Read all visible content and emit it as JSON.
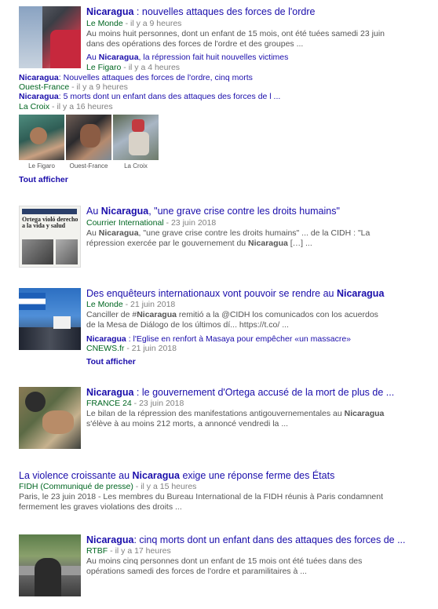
{
  "cluster": {
    "title_prefix": "Nicaragua",
    "title_rest": " : nouvelles attaques des forces de l'ordre",
    "source": "Le Monde",
    "time": " - il y a 9 heures",
    "snippet": "Au moins huit personnes, dont un enfant de 15 mois, ont été tuées samedi 23 juin dans des opérations des forces de l'ordre et des groupes ...",
    "sub1_prefix": "Au ",
    "sub1_bold": "Nicaragua",
    "sub1_rest": ", la répression fait huit nouvelles victimes",
    "sub1_source": "Le Figaro",
    "sub1_time": " - il y a 4 heures",
    "sub2_bold": "Nicaragua",
    "sub2_rest": ": Nouvelles attaques des forces de l'ordre, cinq morts",
    "sub2_source": "Ouest-France",
    "sub2_time": " - il y a 9 heures",
    "sub3_bold": "Nicaragua",
    "sub3_rest": ": 5 morts dont un enfant dans des attaques des forces de l ...",
    "sub3_source": "La Croix",
    "sub3_time": " - il y a 16 heures",
    "thumbs": [
      "Le Figaro",
      "Ouest-France",
      "La Croix"
    ],
    "show_all": "Tout afficher"
  },
  "item1": {
    "title_prefix": "Au ",
    "title_bold": "Nicaragua",
    "title_rest": ", \"une grave crise contre les droits humains\"",
    "source": "Courrier International",
    "time": " - 23 juin 2018",
    "snippet_a": "Au ",
    "snippet_bold": "Nicaragua",
    "snippet_b": ", \"une grave crise contre les droits humains\" ... de la CIDH : \"La répression exercée par le gouvernement du ",
    "snippet_bold2": "Nicaragua",
    "snippet_c": " […] ...",
    "thumb_text": "Ortega violó derecho a la vida y salud"
  },
  "item2": {
    "title_prefix": "Des enquêteurs internationaux vont pouvoir se rendre au ",
    "title_bold": "Nicaragua",
    "source": "Le Monde",
    "time": " - 21 juin 2018",
    "snippet_a": "Canciller de #",
    "snippet_bold": "Nicaragua",
    "snippet_b": " remitió a la @CIDH los comunicados con los acuerdos de la Mesa de Diálogo de los últimos dí... https://t.co/ ...",
    "sub_bold": "Nicaragua",
    "sub_rest": " : l'Eglise en renfort à Masaya pour empêcher «un massacre»",
    "sub_source": "CNEWS.fr",
    "sub_time": " - 21 juin 2018",
    "show_all": "Tout afficher"
  },
  "item3": {
    "title_bold": "Nicaragua",
    "title_rest": " : le gouvernement d'Ortega accusé de la mort de plus de ...",
    "source": "FRANCE 24",
    "time": " - 23 juin 2018",
    "snippet_a": "Le bilan de la répression des manifestations antigouvernementales au ",
    "snippet_bold": "Nicaragua",
    "snippet_b": " s'élève à au moins 212 morts, a annoncé vendredi la ..."
  },
  "item4": {
    "title_prefix": "La violence croissante au ",
    "title_bold": "Nicaragua",
    "title_rest": " exige une réponse ferme des États",
    "source": "FIDH (Communiqué de presse)",
    "time": " - il y a 15 heures",
    "snippet": "Paris, le 23 juin 2018 - Les membres du Bureau International de la FIDH réunis à Paris condamnent fermement les graves violations des droits ..."
  },
  "item5": {
    "title_bold": "Nicaragua",
    "title_rest": ": cinq morts dont un enfant dans des attaques des forces de ...",
    "source": "RTBF",
    "time": " - il y a 17 heures",
    "snippet": "Au moins cinq personnes dont un enfant de 15 mois ont été tuées dans des opérations samedi des forces de l'ordre et paramilitaires à ..."
  }
}
